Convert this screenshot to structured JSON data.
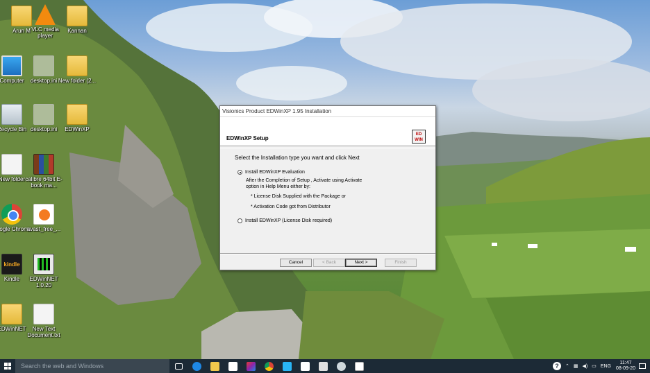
{
  "desktop": {
    "icons": [
      {
        "label": "Arun M"
      },
      {
        "label": "VLC media player"
      },
      {
        "label": "Kannan"
      },
      {
        "label": "Computer"
      },
      {
        "label": "desktop.ini"
      },
      {
        "label": "New folder (2..."
      },
      {
        "label": "Recycle Bin"
      },
      {
        "label": "desktop.ini"
      },
      {
        "label": "EDWinXP"
      },
      {
        "label": "New folder"
      },
      {
        "label": "calibre 64bit E-book ma..."
      },
      {
        "label": "Google Chrome"
      },
      {
        "label": "avast_free_..."
      },
      {
        "label": "Kindle"
      },
      {
        "label": "EDWinNET 1.0.20"
      },
      {
        "label": "EDWinNET"
      },
      {
        "label": "New Text Document.txt"
      }
    ]
  },
  "dialog": {
    "title": "Visionics Product EDWinXP 1.95 Installation",
    "header": "EDWinXP  Setup",
    "logo_text": "ED WIN",
    "prompt": "Select the Installation type you want and click Next",
    "option1": "Install  EDWinXP Evaluation",
    "option1_selected": true,
    "desc_line1": "After the Completion of Setup , Activate using Activate",
    "desc_line2": "option in Help Menu either by:",
    "bullet1": "* License Disk Supplied with the Package or",
    "bullet2": "* Activation Code got from Distributor",
    "option2": "Install  EDWinXP (License Disk required)",
    "option2_selected": false,
    "buttons": {
      "cancel": "Cancel",
      "back": "< Back",
      "next": "Next >",
      "finish": "Finish"
    }
  },
  "taskbar": {
    "search_placeholder": "Search the web and Windows",
    "language": "ENG",
    "time": "11:47",
    "date": "08-09-20"
  }
}
